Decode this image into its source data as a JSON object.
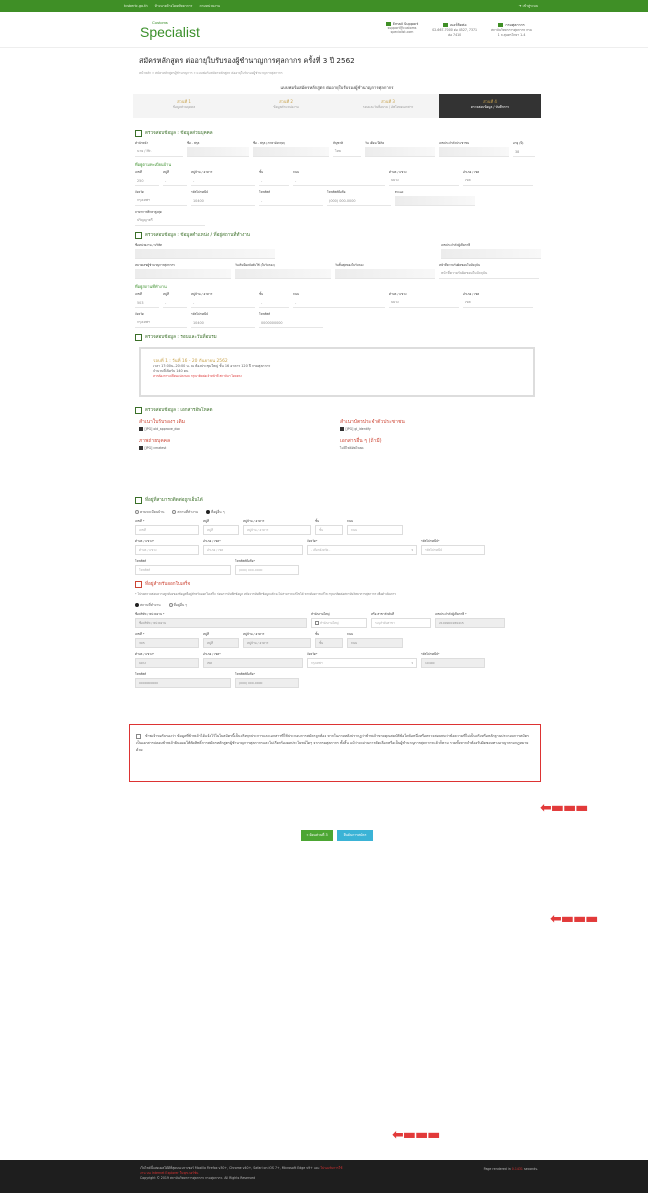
{
  "topbar": {
    "links": [
      "tcsbertc.go.th",
      "ห้างนายจ้างโดยพัทยาการ",
      "ถามหน่วยงาน"
    ],
    "login": "เข้าสู่ระบบ"
  },
  "header": {
    "logo_small": "Customs",
    "logo": "Specialist",
    "contacts": [
      {
        "title": "Email Support",
        "lines": [
          "support@customs",
          "specialist.com"
        ]
      },
      {
        "title": "เบอร์ติดต่อ",
        "lines": [
          "02-667-7000 ต่อ 4527, 7371",
          "ต่อ 7410"
        ]
      },
      {
        "title": "กรมศุลกากร",
        "lines": [
          "สถาบันวิทยาการศุลกากร กรม",
          "1 ถ.สุนทรโกษา 1-4"
        ]
      }
    ]
  },
  "page": {
    "title": "สมัครหลักสูตร ต่ออายุใบรับรองผู้ชำนาญการศุลกากร ครั้งที่ 3 ปี 2562",
    "breadcrumb": "หน้าหลัก » สมัครหลักสูตรผู้ชำนาญการ » แบบฟอร์มสมัครหลักสูตร ต่ออายุใบรับรองผู้ชำนาญการศุลกากร",
    "form_title": "แบบฟอร์มสมัครหลักสูตร ต่ออายุใบรับรองผู้ชำนาญการศุลกากร"
  },
  "steps": [
    {
      "title": "ส่วนที่ 1",
      "label": "ข้อมูลส่วนบุคคล"
    },
    {
      "title": "ส่วนที่ 2",
      "label": "ข้อมูลตำแหน่งงาน"
    },
    {
      "title": "ส่วนที่ 3",
      "label": "รอบและวันที่อบรม / อัพโหลดเอกสาร"
    },
    {
      "title": "ส่วนที่ 4",
      "label": "ตรวจสอบข้อมูล / บันทึกการ"
    }
  ],
  "personal": {
    "section": "ตรวจสอบข้อมูล : ข้อมูลส่วนบุคคล",
    "fields": [
      {
        "label": "คำนำหน้า",
        "value": "นาย / Mr."
      },
      {
        "label": "ชื่อ - สกุล",
        "value": ""
      },
      {
        "label": "ชื่อ - สกุล (ภาษาอังกฤษ)",
        "value": ""
      },
      {
        "label": "สัญชาติ",
        "value": "ไทย"
      },
      {
        "label": "วัน เดือน ปีเกิด",
        "value": ""
      },
      {
        "label": "เลขประจำตัวประชาชน",
        "value": ""
      },
      {
        "label": "อายุ (ปี)",
        "value": "38"
      }
    ]
  },
  "home_address": {
    "title": "ที่อยู่ตามทะเบียนบ้าน",
    "row1": [
      {
        "label": "เลขที่",
        "value": "250"
      },
      {
        "label": "หมู่ที่",
        "value": "-"
      },
      {
        "label": "หมู่บ้าน / อาคาร",
        "value": "-"
      },
      {
        "label": "ชั้น",
        "value": "-"
      },
      {
        "label": "ถนน",
        "value": "-"
      },
      {
        "label": "ตำบล / แขวง",
        "value": "บยวง"
      },
      {
        "label": "อำเภอ / เขต",
        "value": "เขต"
      }
    ],
    "row2": [
      {
        "label": "จังหวัด",
        "value": "กรุงเทพฯ"
      },
      {
        "label": "รหัสไปรษณีย์",
        "value": "10400"
      },
      {
        "label": "โทรศัพท์",
        "value": "-"
      },
      {
        "label": "โทรศัพท์มือถือ",
        "value": "(000) 000-0000"
      },
      {
        "label": "Email",
        "value": ""
      }
    ],
    "edu_label": "ลาษาการศึกษาสูงสุด",
    "edu_value": "ปริญญาตรี"
  },
  "work": {
    "section": "ตรวจสอบข้อมูล : ข้อมูลตำแหน่ง / ที่อยู่สถานที่ทำงาน",
    "row1": [
      {
        "label": "ชื่อหน่วยงาน / บริษัท",
        "value": ""
      },
      {
        "label": "เลขประจำตัวผู้เสียภาษี",
        "value": ""
      }
    ],
    "row2": [
      {
        "label": "หมายเลขผู้ชำนาญการศุลกากร",
        "value": ""
      },
      {
        "label": "วันเริ่มมีผลบังคับใช้ (ใบรับรอง)",
        "value": ""
      },
      {
        "label": "วันสิ้นสุดของใบรับรอง",
        "value": ""
      },
      {
        "label": "หน้าที่ความรับผิดชอบในปัจจุบัน",
        "value": "หน้าที่ความรับผิดชอบในปัจจุบัน"
      }
    ],
    "addr_title": "ที่อยู่สถานที่ทำงาน",
    "row3": [
      {
        "label": "เลขที่",
        "value": "503"
      },
      {
        "label": "หมู่ที่",
        "value": "-"
      },
      {
        "label": "หมู่บ้าน / อาคาร",
        "value": "-"
      },
      {
        "label": "ชั้น",
        "value": "-"
      },
      {
        "label": "ถนน",
        "value": "-"
      },
      {
        "label": "ตำบล / แขวง",
        "value": "บยวง"
      },
      {
        "label": "อำเภอ / เขต",
        "value": "เขต"
      }
    ],
    "row4": [
      {
        "label": "จังหวัด",
        "value": "กรุงเทพฯ"
      },
      {
        "label": "รหัสไปรษณีย์",
        "value": "10400"
      },
      {
        "label": "โทรศัพท์",
        "value": "0000000000"
      }
    ]
  },
  "round": {
    "section": "ตรวจสอบข้อมูล : รอบและวันที่อบรม",
    "name": "รอบที่ 1 : วันที่ 16 - 20 กันยายน 2562",
    "time": "เวลา 17:00น.-20:00 น. ณ ห้องประชุมใหญ่ ชั้น 16 อาคาร 120 ปี กรมศุลกากร",
    "seats": "จำนวนที่เปิดรับ 140 คน",
    "warning": "หากต้องการเปลี่ยนแปลงรอบ กรุณาติดต่อเจ้าหน้าที่ สถาบันฯ โดยตรง"
  },
  "docs": {
    "section": "ตรวจสอบข้อมูล : เอกสารอัพโหลด",
    "items": [
      {
        "title": "สำเนาใบรับรองฯ เดิม",
        "file": "[JPG] old_approve_doc"
      },
      {
        "title": "สำเนาบัตรประจำตัวประชาชน",
        "file": "[JPG] gl_identify"
      },
      {
        "title": "ภาพถ่ายบุคคล",
        "file": "[JPG] cmatest"
      },
      {
        "title": "เอกสารอื่น ๆ (ถ้ามี)",
        "file": "ไม่มีไฟล์อัพโหลด"
      }
    ]
  },
  "contact_addr": {
    "section": "ที่อยู่ที่สามารถติดต่อถูกเอ็นได้",
    "options": [
      "ตามทะเบียนบ้าน",
      "สถานที่ทำงาน",
      "ที่อยู่อื่น ๆ"
    ],
    "row1": [
      {
        "label": "เลขที่ *",
        "ph": "เลขที่"
      },
      {
        "label": "หมู่ที่",
        "ph": "หมู่ที่"
      },
      {
        "label": "หมู่บ้าน / อาคาร",
        "ph": "หมู่บ้าน / อาคาร"
      },
      {
        "label": "ชั้น",
        "ph": "ชั้น"
      },
      {
        "label": "ถนน",
        "ph": "ถนน"
      }
    ],
    "row2": [
      {
        "label": "ตำบล / แขวง*",
        "ph": "ตำบล / แขวง"
      },
      {
        "label": "อำเภอ / เขต*",
        "ph": "อำเภอ / เขต"
      },
      {
        "label": "จังหวัด*",
        "ph": "- เลือกจังหวัด -"
      },
      {
        "label": "รหัสไปรษณีย์*",
        "ph": "รหัสไปรษณีย์"
      }
    ],
    "row3": [
      {
        "label": "โทรศัพท์",
        "ph": "โทรศัพท์"
      },
      {
        "label": "โทรศัพท์มือถือ*",
        "ph": "(000) 000-0000"
      }
    ]
  },
  "receipt": {
    "section": "ที่อยู่สำหรับออกใบเสร็จ",
    "note": "* โปรดตรวจสอบความถูกต้องของข้อมูลที่อยู่สำหรับออกใบเสร็จ ก่อนการบันทึกข้อมูล หลังจากบันทึกข้อมูลแล้วจะไม่สามารถแก้ไขได้ หากต้องการแก้ไข กรุณาติดต่อสถาบันวิทยาการศุลกากร เพื่อดำเนินการ",
    "options": [
      "สถานที่ทำงาน",
      "ที่อยู่อื่น ๆ"
    ],
    "row0": [
      {
        "label": "ชื่อบริษัท / หน่วยงาน *",
        "ph": "ชื่อบริษัท / หน่วยงาน"
      },
      {
        "label": "สำนักงานใหญ่",
        "ph": "สำนักงานใหญ่"
      },
      {
        "label": "หรือ สาขาลำดับที่",
        "ph": "ระบุลำดับสาขา"
      },
      {
        "label": "เลขประจำตัวผู้เสียภาษี *",
        "ph": "2109900189415"
      }
    ],
    "row1": [
      {
        "label": "เลขที่ *",
        "ph": "305"
      },
      {
        "label": "หมู่ที่",
        "ph": "หมู่ที่"
      },
      {
        "label": "หมู่บ้าน / อาคาร",
        "ph": "หมู่บ้าน / อาคาร"
      },
      {
        "label": "ชั้น",
        "ph": "ชั้น"
      },
      {
        "label": "ถนน",
        "ph": "ถนน"
      }
    ],
    "row2": [
      {
        "label": "ตำบล / แขวง*",
        "ph": "บยวง"
      },
      {
        "label": "อำเภอ / เขต*",
        "ph": "เขต"
      },
      {
        "label": "จังหวัด*",
        "ph": "กรุงเทพฯ"
      },
      {
        "label": "รหัสไปรษณีย์*",
        "ph": "10400"
      }
    ],
    "row3": [
      {
        "label": "โทรศัพท์",
        "ph": "0000000000"
      },
      {
        "label": "โทรศัพท์มือถือ*",
        "ph": "(000) 000-0000"
      }
    ]
  },
  "agreement": "ข้าพเจ้าขอรับรองว่า ข้อมูลที่ข้าพเจ้าได้แจ้งไว้ในใบสมัครนี้เป็นจริงทุกประการและเอกสารที่ใช้ประกอบการสมัครถูกต้อง หากในภายหลังปรากฏว่าข้าพเจ้าขาดคุณสมบัติข้อใดข้อหนึ่งหรือตรวจสอบพบว่าข้อความที่ไม่เป็นจริงหรือหลักฐานประกอบการสมัคร เป็นเอกสารปลอมข้าพเจ้ายินยอมให้ตัดสิทธิ์การสมัครหลักสูตรผู้ชำนาญการศุลกากรและไม่เรียกร้องผลประโยชน์ใดๆ จากกรมศุลกากร ทั้งสิ้น แม้ว่าจะผ่านการคัดเลือกหรือเป็นผู้ชำนาญการศุลกากรแล้วก็ตาม รวมทั้งหากจำต้องรับผิดชอบทางอาญาตามกฎหมายด้วย",
  "buttons": {
    "back": "« ย้อนส่วนที่ 3",
    "submit": "ยืนยันการสมัคร"
  },
  "footer": {
    "line1": "เว็บไซต์นี้แสดงผลได้ดีที่สุดบนเบราเซอร์ Mozilla Firefox v30+, Chrome v40+, Safari on iOS 7+, Microsoft Edge v9+ และ",
    "line1_red": "ไม่รองรับการใช้",
    "line2": "งาน บน Internet Explorer ในทุกเวอร์ชั่น",
    "line3": "Copyright © 2019 สถาบันวิทยาการศุลกากร กรมศุลกากร. All Rights Reserved",
    "rendered_prefix": "Page rendered in",
    "rendered_value": "0.1431",
    "rendered_suffix": "seconds."
  }
}
